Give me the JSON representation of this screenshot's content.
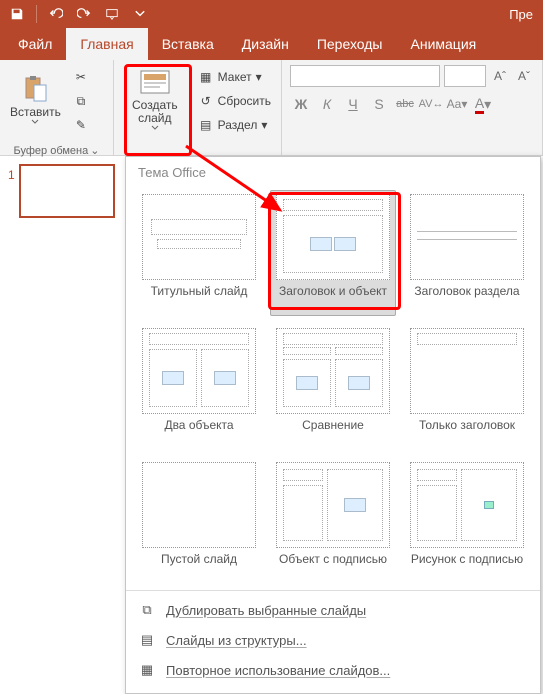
{
  "app": {
    "title": "Пре"
  },
  "qat": {
    "save": "save",
    "undo": "undo",
    "redo": "redo",
    "start": "start-from-beginning"
  },
  "tabs": {
    "file": "Файл",
    "home": "Главная",
    "insert": "Вставка",
    "design": "Дизайн",
    "transitions": "Переходы",
    "animation": "Анимация"
  },
  "ribbon": {
    "clipboard": {
      "paste": "Вставить",
      "group_label": "Буфер обмена"
    },
    "slides": {
      "new_slide": "Создать слайд",
      "layout": "Макет",
      "reset": "Сбросить",
      "section": "Раздел"
    },
    "font": {
      "bold": "Ж",
      "italic": "К",
      "underline": "Ч",
      "shadow": "S",
      "strike": "abc",
      "spacing": "AV",
      "case": "Aa",
      "color": "A",
      "grow": "A",
      "shrink": "A"
    }
  },
  "slide_panel": {
    "slide_number": "1"
  },
  "dropdown": {
    "header": "Тема Office",
    "layouts": [
      {
        "id": "title_slide",
        "label": "Титульный слайд"
      },
      {
        "id": "title_content",
        "label": "Заголовок и объект",
        "selected": true
      },
      {
        "id": "section_header",
        "label": "Заголовок раздела"
      },
      {
        "id": "two_content",
        "label": "Два объекта"
      },
      {
        "id": "comparison",
        "label": "Сравнение"
      },
      {
        "id": "title_only",
        "label": "Только заголовок"
      },
      {
        "id": "blank",
        "label": "Пустой слайд"
      },
      {
        "id": "content_caption",
        "label": "Объект с подписью"
      },
      {
        "id": "picture_caption",
        "label": "Рисунок с подписью"
      }
    ],
    "actions": {
      "duplicate": "Дублировать выбранные слайды",
      "from_outline": "Слайды из структуры...",
      "reuse": "Повторное использование слайдов..."
    }
  }
}
